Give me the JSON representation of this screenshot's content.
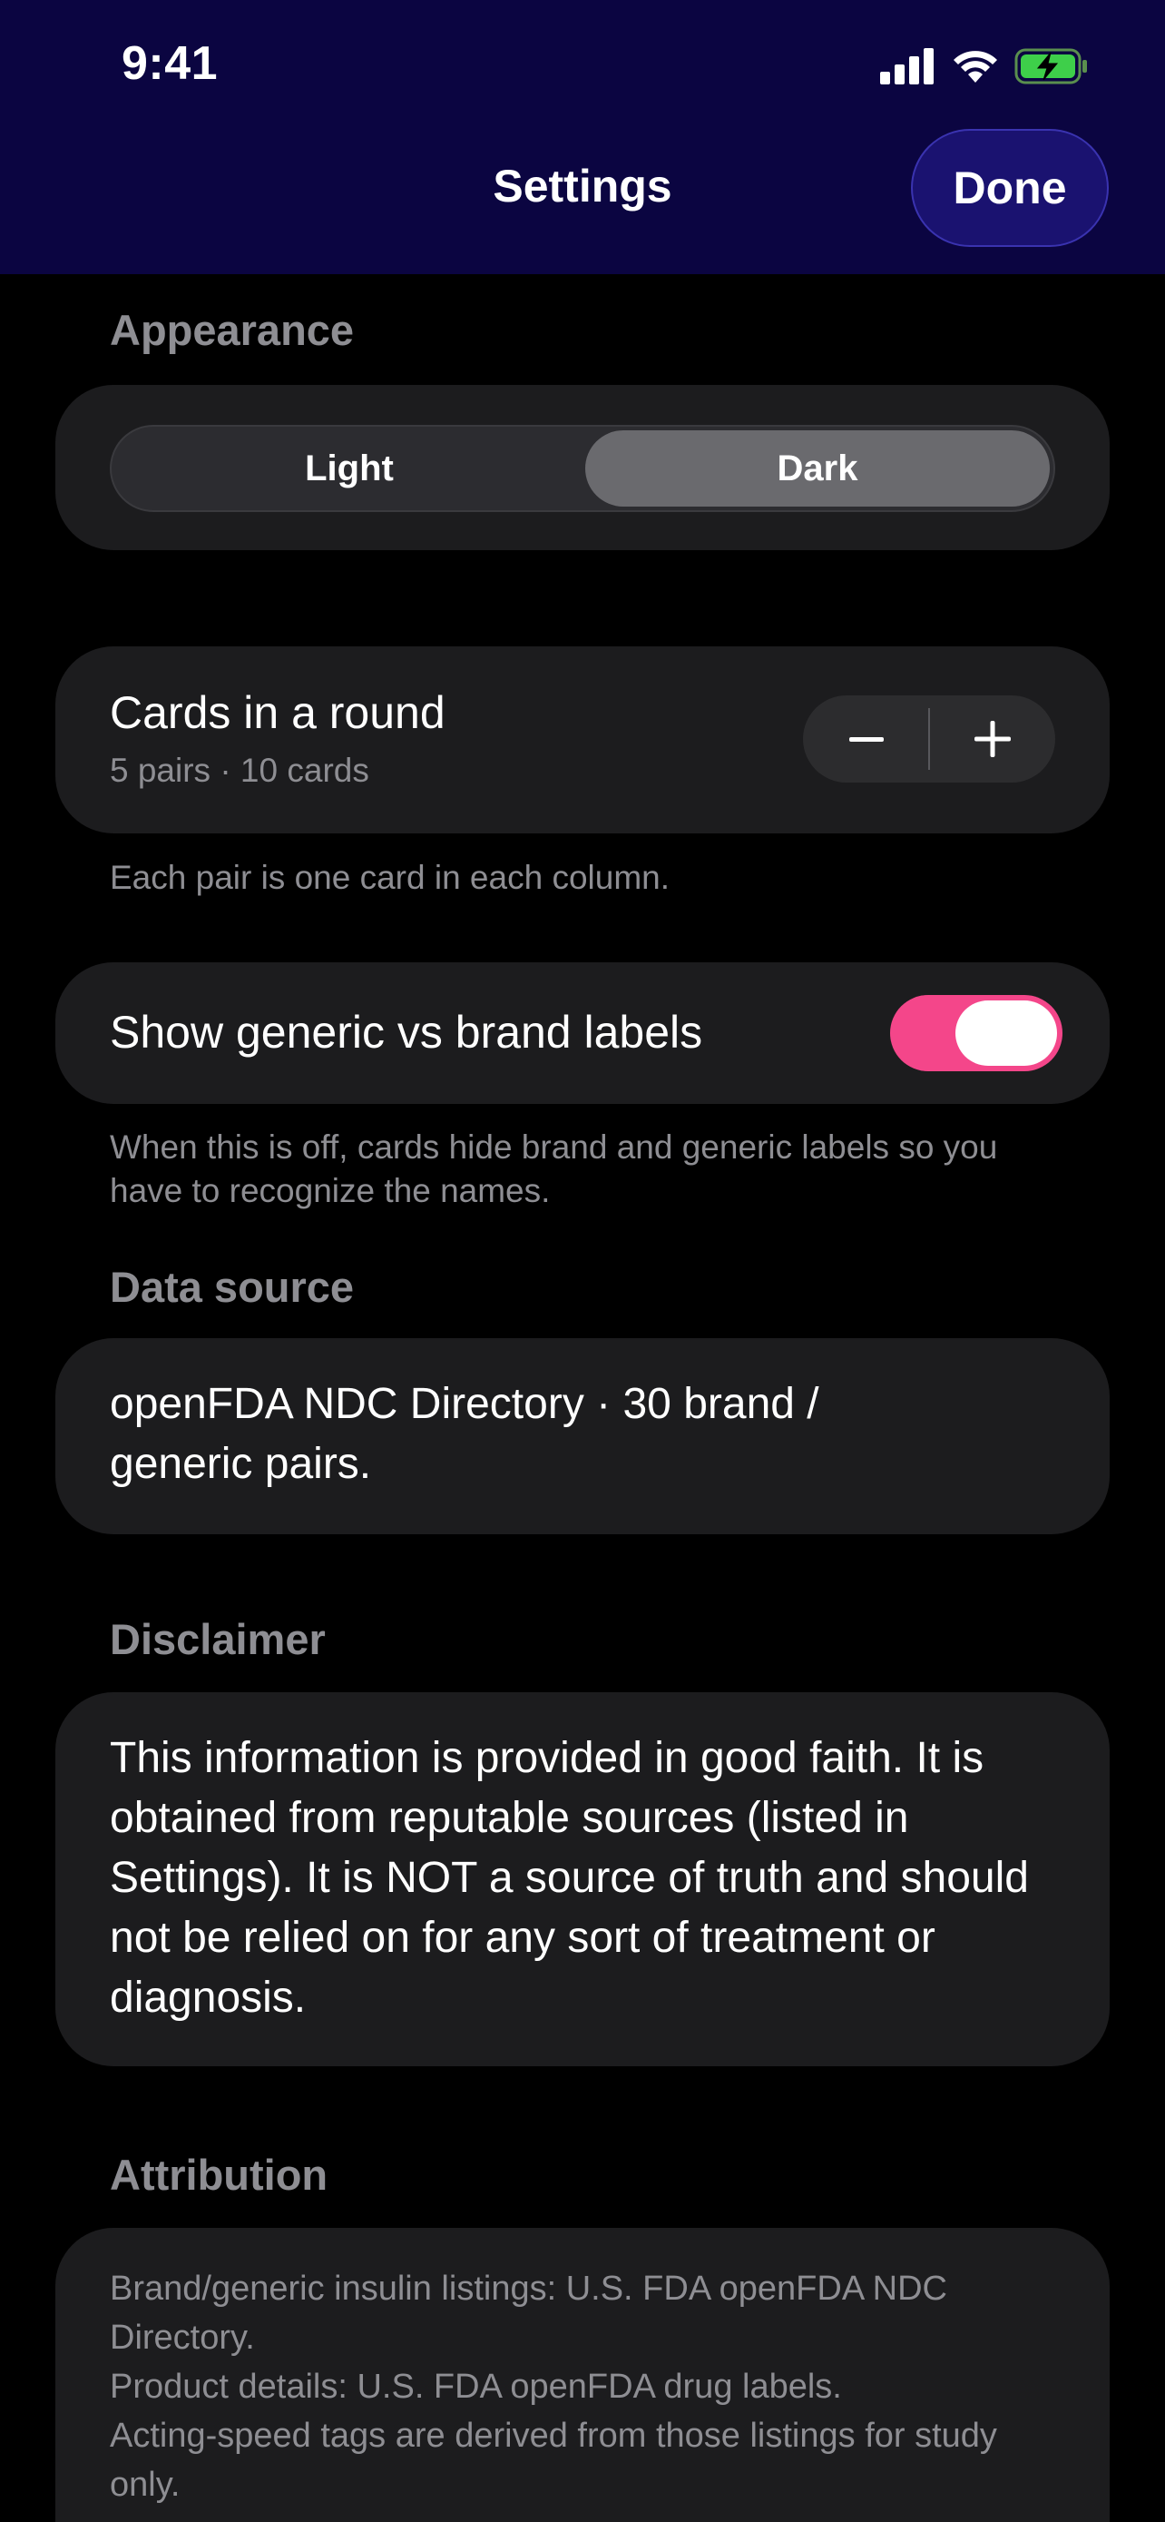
{
  "status_bar": {
    "time": "9:41"
  },
  "nav": {
    "title": "Settings",
    "done_label": "Done"
  },
  "appearance": {
    "section_title": "Appearance",
    "options": [
      "Light",
      "Dark"
    ],
    "selected": "Dark"
  },
  "cards_round": {
    "title": "Cards in a round",
    "subtitle": "5 pairs · 10 cards",
    "footnote": "Each pair is one card in each column."
  },
  "labels_toggle": {
    "label": "Show generic vs brand labels",
    "footnote": "When this is off, cards hide brand and generic labels so you have to recognize the names."
  },
  "data_source": {
    "section_title": "Data source",
    "text": "openFDA NDC Directory · 30 brand / generic pairs."
  },
  "disclaimer": {
    "section_title": "Disclaimer",
    "text": "This information is provided in good faith. It is obtained from reputable sources (listed in Settings). It is NOT a source of truth and should not be relied on for any sort of treatment or diagnosis."
  },
  "attribution": {
    "section_title": "Attribution",
    "lines": [
      "Brand/generic insulin listings: U.S. FDA openFDA NDC Directory.",
      "Product details: U.S. FDA openFDA drug labels.",
      "Acting-speed tags are derived from those listings for study only."
    ]
  },
  "colors": {
    "header_bg": "#0b0541",
    "toggle_on": "#f4468a",
    "card_bg": "#1c1c1e",
    "secondary_text": "#8e8e93"
  }
}
